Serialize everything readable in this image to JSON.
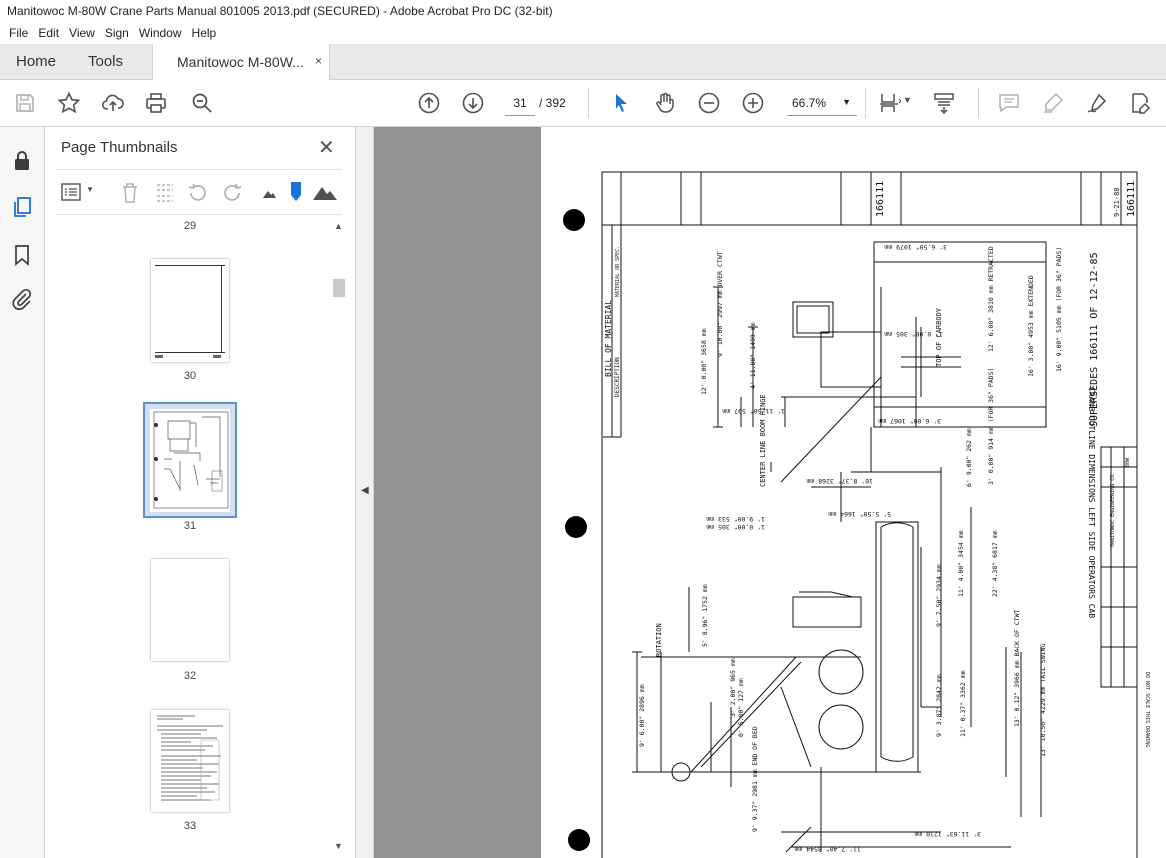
{
  "window": {
    "title": "Manitowoc M-80W Crane Parts Manual 801005 2013.pdf (SECURED) - Adobe Acrobat Pro DC (32-bit)"
  },
  "menu": [
    "File",
    "Edit",
    "View",
    "Sign",
    "Window",
    "Help"
  ],
  "tabs": {
    "home": "Home",
    "tools": "Tools",
    "document": "Manitowoc M-80W...",
    "close": "×"
  },
  "toolbar": {
    "current_page": "31",
    "total_pages": "/ 392",
    "zoom": "66.7%"
  },
  "thumbnails": {
    "title": "Page Thumbnails",
    "pages": [
      {
        "label": "29"
      },
      {
        "label": "30"
      },
      {
        "label": "31",
        "selected": true
      },
      {
        "label": "32"
      },
      {
        "label": "33"
      }
    ]
  },
  "drawing": {
    "title_block": {
      "title": "CRANE OUTLINE DIMENSIONS LEFT SIDE OPERATORS CAB",
      "supersedes": "SUPERSEDES 166111 OF 12-12-85",
      "number": "166111",
      "date": "9-21-88",
      "company": "MANITOWOC ENGINEERING CO.",
      "model": "80W",
      "note": "DO NOT SCALE THIS DRAWING",
      "bom_header": "BILL OF MATERIAL",
      "bom_cols": [
        "DESCRIPTION",
        "MATERIAL OR SPEC."
      ]
    },
    "dimensions": [
      {
        "label": "3' 6.50\"",
        "mm": "1079 mm"
      },
      {
        "label": "9' 10.00\"",
        "mm": "2997 mm",
        "note": "OVER CTWT"
      },
      {
        "label": "12' 0.00\"",
        "mm": "3658 mm"
      },
      {
        "label": "4' 11.00\"",
        "mm": "1499 mm"
      },
      {
        "label": "1' 11.50\"",
        "mm": "597 mm"
      },
      {
        "label": "1' 0.00\"",
        "mm": "305 mm"
      },
      {
        "label": "3' 6.00\"",
        "mm": "1067 mm"
      },
      {
        "label": "12' 6.00\"",
        "mm": "3810 mm",
        "note": "RETRACTED"
      },
      {
        "label": "16' 3.00\"",
        "mm": "4953 mm",
        "note": "EXTENDED"
      },
      {
        "label": "16' 9.00\"",
        "mm": "5105 mm",
        "note": "(FOR 36\" PADS)"
      },
      {
        "label": "10' 8.37\"",
        "mm": "3268 mm"
      },
      {
        "label": "5' 5.50\"",
        "mm": "1664 mm"
      },
      {
        "label": "1' 9.00\"",
        "mm": "533 mm"
      },
      {
        "label": "1' 0.00\"",
        "mm": "305 mm"
      },
      {
        "label": "3' 0.00\"",
        "mm": "914 mm",
        "note": "(FOR 36\" PADS)"
      },
      {
        "label": "6' 9.00\"",
        "mm": "262 mm"
      },
      {
        "label": "5' 8.96\"",
        "mm": "1752 mm"
      },
      {
        "label": "9' 7.50\"",
        "mm": "2934 mm"
      },
      {
        "label": "11' 4.00\"",
        "mm": "3454 mm"
      },
      {
        "label": "22' 4.38\"",
        "mm": "6817 mm"
      },
      {
        "label": "3' 2.00\"",
        "mm": "965 mm"
      },
      {
        "label": "0' 5.00\"",
        "mm": "127 mm"
      },
      {
        "label": "9' 6.00\"",
        "mm": "2896 mm"
      },
      {
        "label": "9' 3.87\"",
        "mm": "2842 mm"
      },
      {
        "label": "11' 0.37\"",
        "mm": "3362 mm"
      },
      {
        "label": "13' 0.12\"",
        "mm": "3966 mm",
        "note": "BACK OF CTWT"
      },
      {
        "label": "13' 10.50\"",
        "mm": "4229 mm",
        "note": "TAIL SWING"
      },
      {
        "label": "9' 9.37\"",
        "mm": "2981 mm",
        "note": "END OF BED"
      },
      {
        "label": "11' 7.40\"",
        "mm": "3544 mm"
      },
      {
        "label": "3' 11.63\"",
        "mm": "1210 mm"
      }
    ],
    "callouts": [
      "TOP OF CARBODY",
      "CENTER LINE BOOM HINGE",
      "ROTATION"
    ]
  }
}
